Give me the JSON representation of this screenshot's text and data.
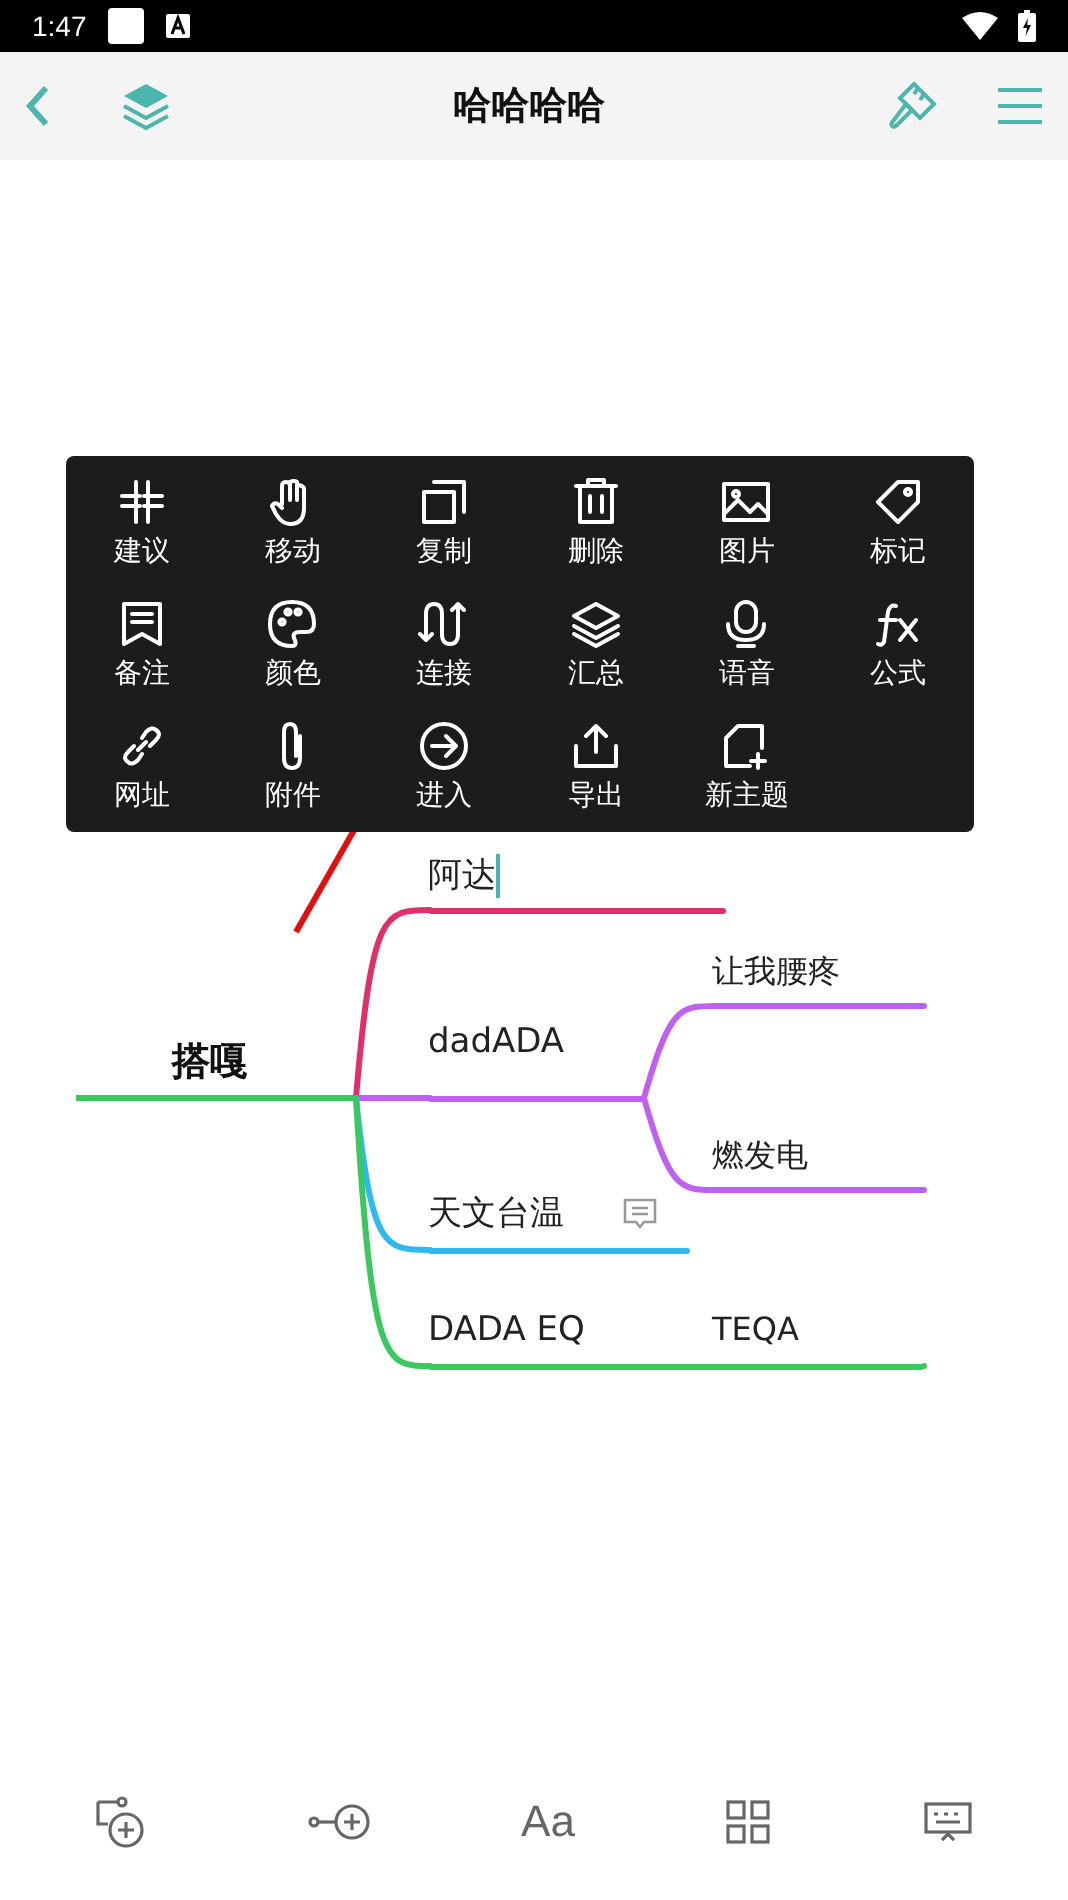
{
  "status_bar": {
    "time": "1:47"
  },
  "header": {
    "title": "哈哈哈哈"
  },
  "context_menu": {
    "items": [
      {
        "label": "建议"
      },
      {
        "label": "移动"
      },
      {
        "label": "复制"
      },
      {
        "label": "删除"
      },
      {
        "label": "图片"
      },
      {
        "label": "标记"
      },
      {
        "label": "备注"
      },
      {
        "label": "颜色"
      },
      {
        "label": "连接"
      },
      {
        "label": "汇总"
      },
      {
        "label": "语音"
      },
      {
        "label": "公式"
      },
      {
        "label": "网址"
      },
      {
        "label": "附件"
      },
      {
        "label": "进入"
      },
      {
        "label": "导出"
      },
      {
        "label": "新主题"
      }
    ]
  },
  "mind_map": {
    "root": "搭嘎",
    "branches": [
      {
        "label": "阿达",
        "color": "#e0306a",
        "editing": true
      },
      {
        "label": "dadADA",
        "color": "#c060f0",
        "editing": false,
        "children": [
          {
            "label": "让我腰疼"
          },
          {
            "label": "燃发电"
          }
        ]
      },
      {
        "label": "天文台温",
        "color": "#30b8f0",
        "editing": false,
        "has_note": true
      },
      {
        "label": "DADA EQ",
        "color": "#3cc860",
        "editing": false,
        "children": [
          {
            "label": "TEQA"
          }
        ]
      }
    ]
  },
  "bottom_toolbar": {
    "font_button": "Aa"
  }
}
